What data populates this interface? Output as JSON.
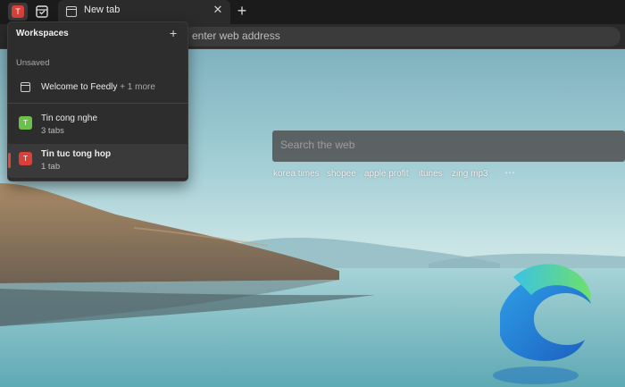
{
  "tabstrip": {
    "workspace_badge": "T",
    "tab_title": "New tab",
    "close_glyph": "✕",
    "newtab_glyph": "+"
  },
  "toolbar": {
    "address_placeholder": "enter web address"
  },
  "search": {
    "placeholder": "Search the web"
  },
  "quick_links": [
    "korea times",
    "shopee",
    "apple profit",
    "itunes",
    "zing mp3"
  ],
  "quick_links_more": "⋯",
  "workspaces": {
    "title": "Workspaces",
    "add_glyph": "+",
    "section_label": "Unsaved",
    "unsaved": {
      "name": "Welcome to Feedly",
      "more": "+ 1 more"
    },
    "items": [
      {
        "badge": "T",
        "name": "Tin cong nghe",
        "tabs": "3 tabs",
        "color": "#6cc04a"
      },
      {
        "badge": "T",
        "name": "Tin tuc tong hop",
        "tabs": "1 tab",
        "color": "#d9403a"
      }
    ]
  },
  "colors": {
    "accent_red": "#d9403a",
    "accent_green": "#6cc04a"
  }
}
